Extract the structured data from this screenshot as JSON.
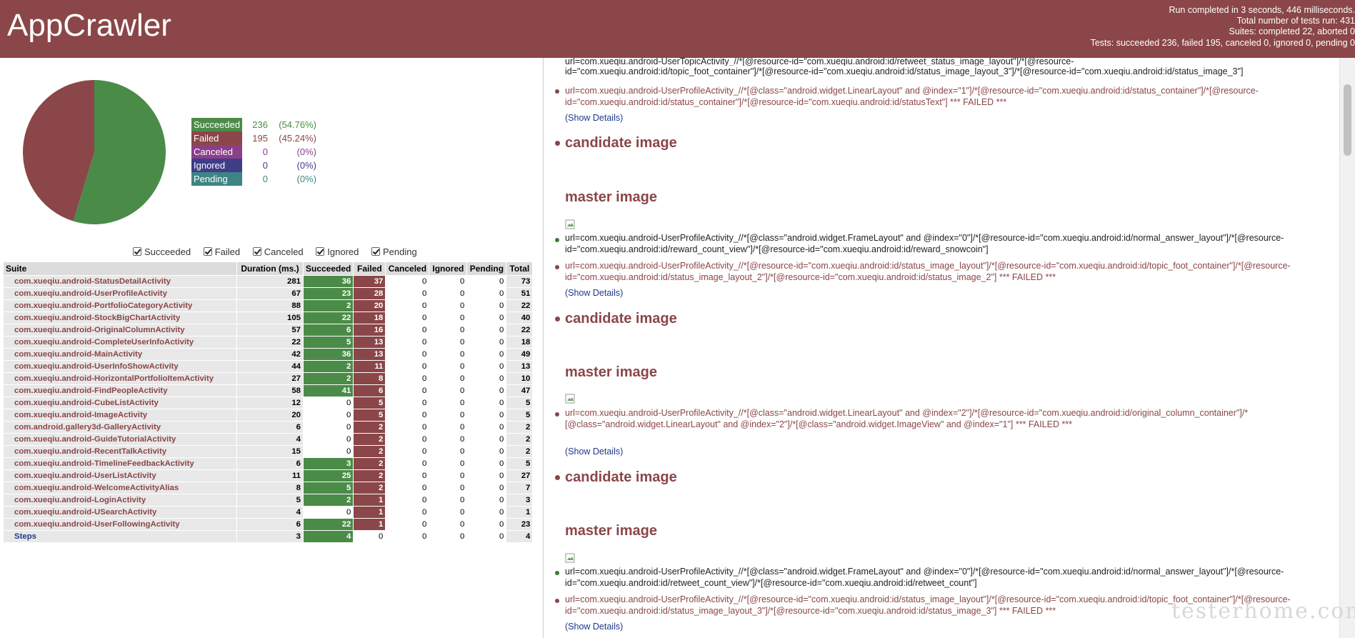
{
  "header": {
    "title": "AppCrawler",
    "summary": [
      "Run completed in 3 seconds, 446 milliseconds.",
      "Total number of tests run: 431",
      "Suites: completed 22, aborted 0",
      "Tests: succeeded 236, failed 195, canceled 0, ignored 0, pending 0"
    ]
  },
  "colors": {
    "header": "#8a4648",
    "succeeded": "#4b8b48",
    "failed": "#8a4648",
    "canceled": "#8b3f8a",
    "ignored": "#3f3d88",
    "pending": "#3e8484"
  },
  "pie": {
    "succeeded": 236,
    "failed": 195
  },
  "legend": [
    {
      "label": "Succeeded",
      "count": "236",
      "pct": "(54.76%)",
      "color": "#4b8b48"
    },
    {
      "label": "Failed",
      "count": "195",
      "pct": "(45.24%)",
      "color": "#8a4648"
    },
    {
      "label": "Canceled",
      "count": "0",
      "pct": "(0%)",
      "color": "#8b3f8a"
    },
    {
      "label": "Ignored",
      "count": "0",
      "pct": "(0%)",
      "color": "#3f3d88"
    },
    {
      "label": "Pending",
      "count": "0",
      "pct": "(0%)",
      "color": "#3e8484"
    }
  ],
  "filters": [
    "Succeeded",
    "Failed",
    "Canceled",
    "Ignored",
    "Pending"
  ],
  "table": {
    "headers": [
      "Suite",
      "Duration (ms.)",
      "Succeeded",
      "Failed",
      "Canceled",
      "Ignored",
      "Pending",
      "Total"
    ],
    "rows": [
      [
        "com.xueqiu.android-StatusDetailActivity",
        "281",
        "36",
        "37",
        "0",
        "0",
        "0",
        "73"
      ],
      [
        "com.xueqiu.android-UserProfileActivity",
        "67",
        "23",
        "28",
        "0",
        "0",
        "0",
        "51"
      ],
      [
        "com.xueqiu.android-PortfolioCategoryActivity",
        "88",
        "2",
        "20",
        "0",
        "0",
        "0",
        "22"
      ],
      [
        "com.xueqiu.android-StockBigChartActivity",
        "105",
        "22",
        "18",
        "0",
        "0",
        "0",
        "40"
      ],
      [
        "com.xueqiu.android-OriginalColumnActivity",
        "57",
        "6",
        "16",
        "0",
        "0",
        "0",
        "22"
      ],
      [
        "com.xueqiu.android-CompleteUserInfoActivity",
        "22",
        "5",
        "13",
        "0",
        "0",
        "0",
        "18"
      ],
      [
        "com.xueqiu.android-MainActivity",
        "42",
        "36",
        "13",
        "0",
        "0",
        "0",
        "49"
      ],
      [
        "com.xueqiu.android-UserInfoShowActivity",
        "44",
        "2",
        "11",
        "0",
        "0",
        "0",
        "13"
      ],
      [
        "com.xueqiu.android-HorizontalPortfolioItemActivity",
        "27",
        "2",
        "8",
        "0",
        "0",
        "0",
        "10"
      ],
      [
        "com.xueqiu.android-FindPeopleActivity",
        "58",
        "41",
        "6",
        "0",
        "0",
        "0",
        "47"
      ],
      [
        "com.xueqiu.android-CubeListActivity",
        "12",
        "0",
        "5",
        "0",
        "0",
        "0",
        "5"
      ],
      [
        "com.xueqiu.android-ImageActivity",
        "20",
        "0",
        "5",
        "0",
        "0",
        "0",
        "5"
      ],
      [
        "com.android.gallery3d-GalleryActivity",
        "6",
        "0",
        "2",
        "0",
        "0",
        "0",
        "2"
      ],
      [
        "com.xueqiu.android-GuideTutorialActivity",
        "4",
        "0",
        "2",
        "0",
        "0",
        "0",
        "2"
      ],
      [
        "com.xueqiu.android-RecentTalkActivity",
        "15",
        "0",
        "2",
        "0",
        "0",
        "0",
        "2"
      ],
      [
        "com.xueqiu.android-TimelineFeedbackActivity",
        "6",
        "3",
        "2",
        "0",
        "0",
        "0",
        "5"
      ],
      [
        "com.xueqiu.android-UserListActivity",
        "11",
        "25",
        "2",
        "0",
        "0",
        "0",
        "27"
      ],
      [
        "com.xueqiu.android-WelcomeActivityAlias",
        "8",
        "5",
        "2",
        "0",
        "0",
        "0",
        "7"
      ],
      [
        "com.xueqiu.android-LoginActivity",
        "5",
        "2",
        "1",
        "0",
        "0",
        "0",
        "3"
      ],
      [
        "com.xueqiu.android-USearchActivity",
        "4",
        "0",
        "1",
        "0",
        "0",
        "0",
        "1"
      ],
      [
        "com.xueqiu.android-UserFollowingActivity",
        "6",
        "22",
        "1",
        "0",
        "0",
        "0",
        "23"
      ],
      [
        "Steps",
        "3",
        "4",
        "0",
        "0",
        "0",
        "0",
        "4"
      ]
    ]
  },
  "details": {
    "top_partial_url": "url=com.xueqiu.android-UserTopicActivity_//*[@resource-id=\"com.xueqiu.android:id/retweet_status_image_layout\"]/*[@resource-",
    "top_partial_url2": "id=\"com.xueqiu.android:id/topic_foot_container\"]/*[@resource-id=\"com.xueqiu.android:id/status_image_layout_3\"]/*[@resource-id=\"com.xueqiu.android:id/status_image_3\"]",
    "fail1": "url=com.xueqiu.android-UserProfileActivity_//*[@class=\"android.widget.LinearLayout\" and @index=\"1\"]/*[@resource-id=\"com.xueqiu.android:id/status_container\"]/*[@resource-id=\"com.xueqiu.android:id/status_container\"]/*[@resource-id=\"com.xueqiu.android:id/statusText\"] *** FAILED ***",
    "show_details": "(Show Details)",
    "candidate": "candidate image",
    "master": "master image",
    "ok2": "url=com.xueqiu.android-UserProfileActivity_//*[@class=\"android.widget.FrameLayout\" and @index=\"0\"]/*[@resource-id=\"com.xueqiu.android:id/normal_answer_layout\"]/*[@resource-id=\"com.xueqiu.android:id/reward_count_view\"]/*[@resource-id=\"com.xueqiu.android:id/reward_snowcoin\"]",
    "fail2": "url=com.xueqiu.android-UserProfileActivity_//*[@resource-id=\"com.xueqiu.android:id/status_image_layout\"]/*[@resource-id=\"com.xueqiu.android:id/topic_foot_container\"]/*[@resource-id=\"com.xueqiu.android:id/status_image_layout_2\"]/*[@resource-id=\"com.xueqiu.android:id/status_image_2\"] *** FAILED ***",
    "fail3": "url=com.xueqiu.android-UserProfileActivity_//*[@class=\"android.widget.LinearLayout\" and @index=\"2\"]/*[@resource-id=\"com.xueqiu.android:id/original_column_container\"]/*[@class=\"android.widget.LinearLayout\" and @index=\"2\"]/*[@class=\"android.widget.ImageView\" and @index=\"1\"] *** FAILED ***",
    "ok4": "url=com.xueqiu.android-UserProfileActivity_//*[@class=\"android.widget.FrameLayout\" and @index=\"0\"]/*[@resource-id=\"com.xueqiu.android:id/normal_answer_layout\"]/*[@resource-id=\"com.xueqiu.android:id/retweet_count_view\"]/*[@resource-id=\"com.xueqiu.android:id/retweet_count\"]",
    "fail4": "url=com.xueqiu.android-UserProfileActivity_//*[@resource-id=\"com.xueqiu.android:id/status_image_layout\"]/*[@resource-id=\"com.xueqiu.android:id/topic_foot_container\"]/*[@resource-id=\"com.xueqiu.android:id/status_image_layout_3\"]/*[@resource-id=\"com.xueqiu.android:id/status_image_3\"] *** FAILED ***"
  },
  "watermark": "testerhome.com"
}
